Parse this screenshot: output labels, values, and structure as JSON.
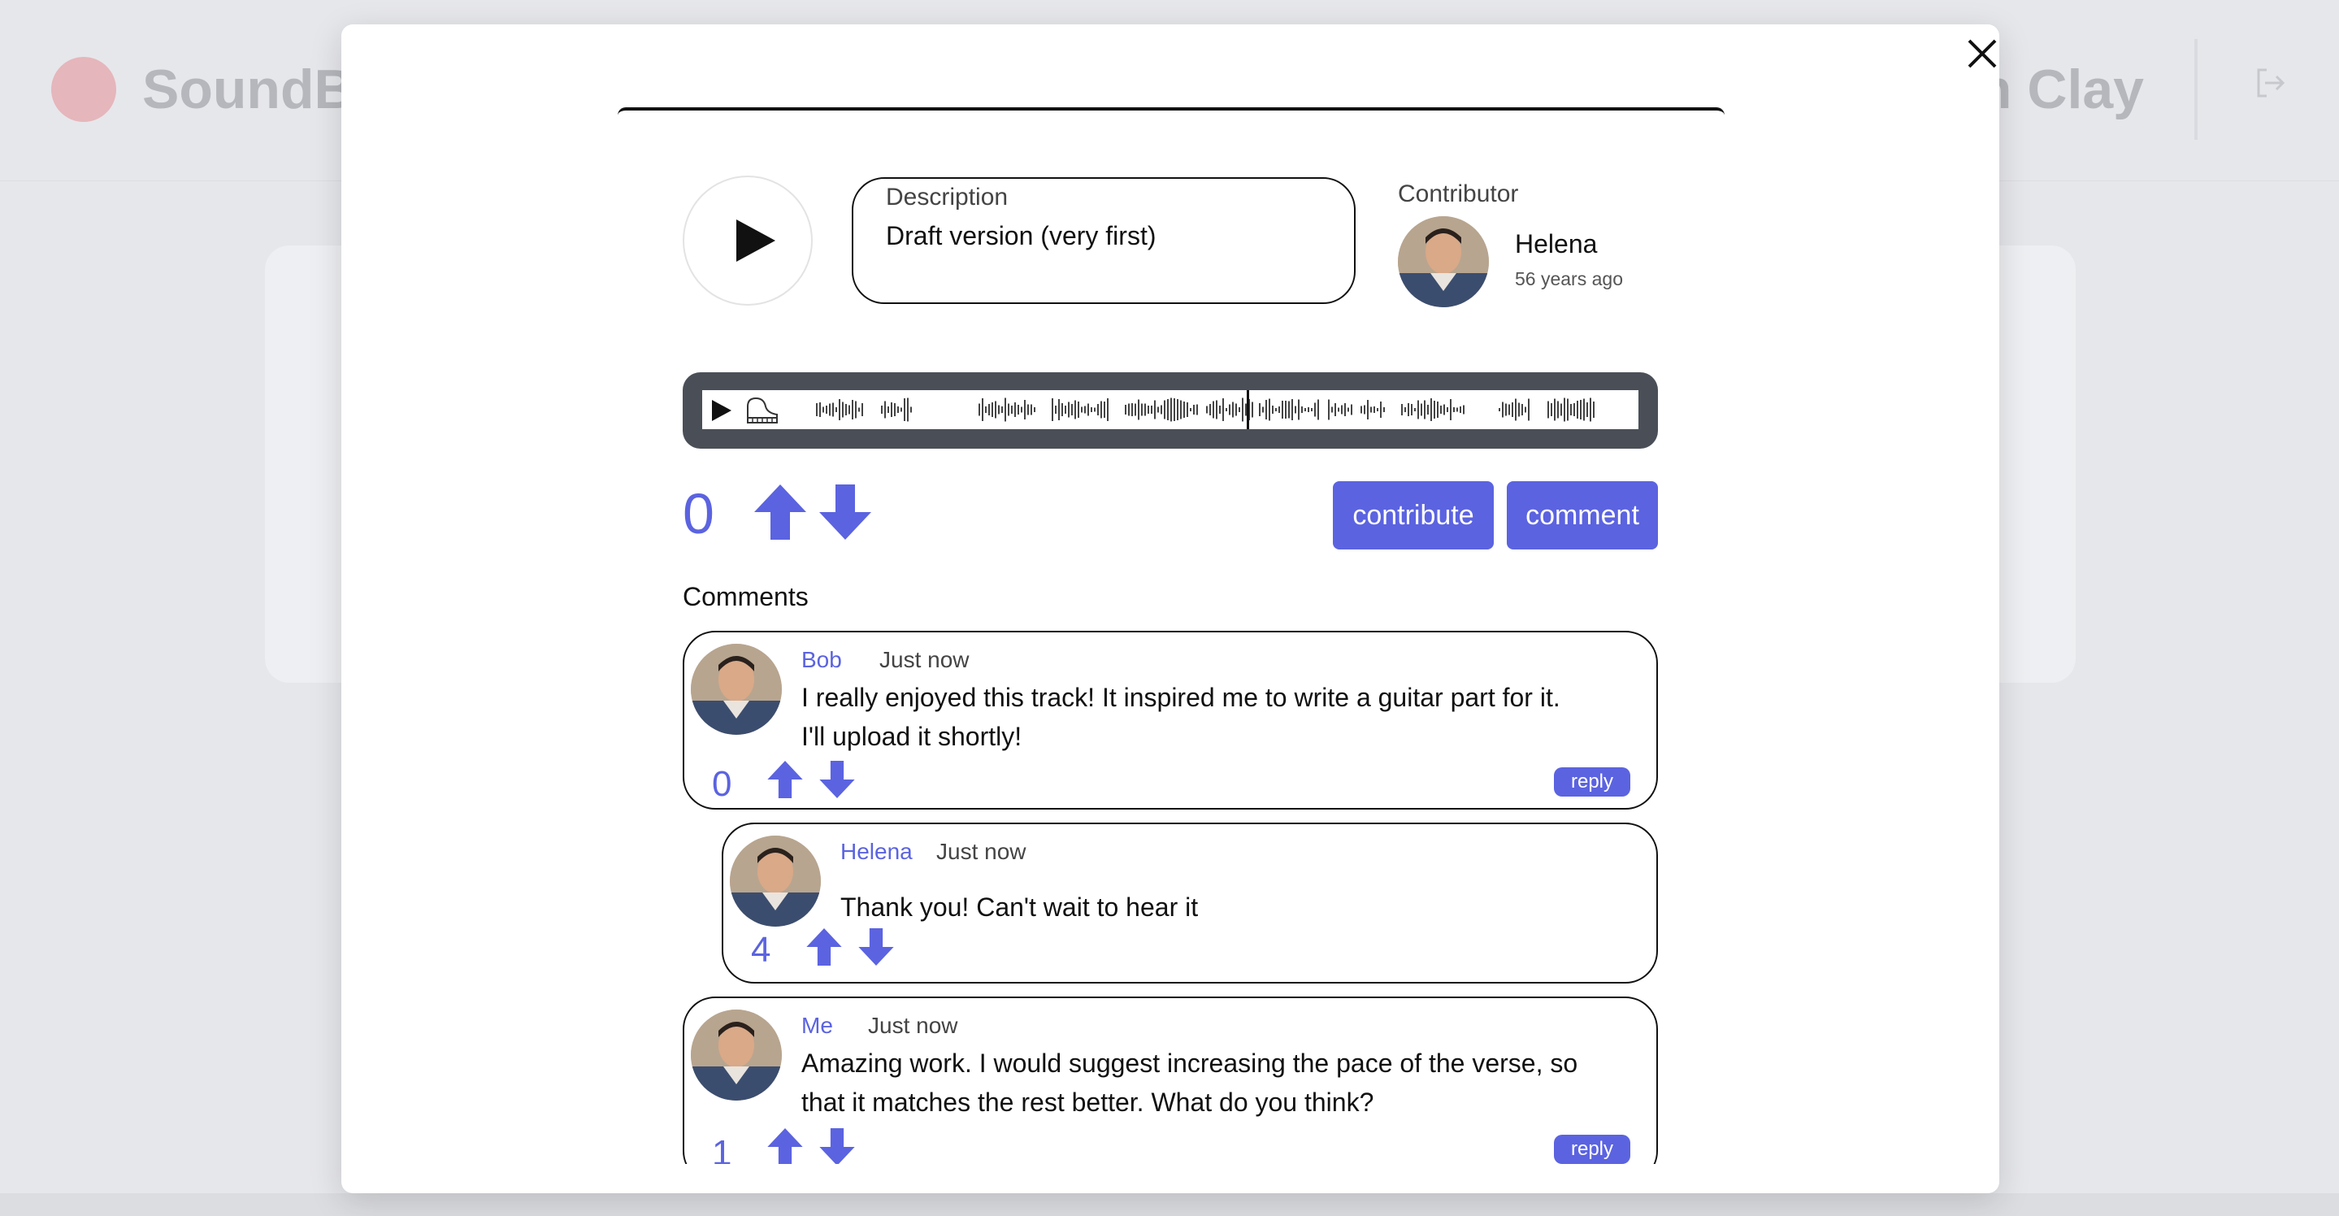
{
  "background": {
    "brand_name": "SoundB",
    "user_name": "n Clay",
    "logout_icon": "logout-icon"
  },
  "modal": {
    "close_icon": "close-icon",
    "track": {
      "play_icon": "play-icon",
      "description_label": "Description",
      "description": "Draft version (very first)",
      "contributor_label": "Contributor",
      "contributor_name": "Helena",
      "contributor_time": "56 years ago"
    },
    "player": {
      "play_icon": "play-icon",
      "piano_icon": "piano-icon"
    },
    "votes": {
      "score": "0",
      "upvote_icon": "arrow-up-icon",
      "downvote_icon": "arrow-down-icon"
    },
    "actions": {
      "contribute_label": "contribute",
      "comment_label": "comment"
    },
    "comments_heading": "Comments",
    "comments": [
      {
        "author": "Bob",
        "time": "Just now",
        "text_line1": "I really enjoyed this track! It inspired me to write a guitar part for it.",
        "text_line2": "I'll upload it shortly!",
        "score": "0",
        "reply_label": "reply"
      },
      {
        "author": "Helena",
        "time": "Just now",
        "text_line1": "Thank you! Can't wait to hear it",
        "score": "4"
      },
      {
        "author": "Me",
        "time": "Just now",
        "text_line1": "Amazing work. I would suggest increasing the pace of the verse, so",
        "text_line2": "that it matches the rest better. What do you think?",
        "score": "1",
        "reply_label": "reply"
      }
    ]
  },
  "colors": {
    "accent": "#5b63e0",
    "player_frame": "#4a4f57",
    "overlay_bg": "#e6e7eb"
  }
}
